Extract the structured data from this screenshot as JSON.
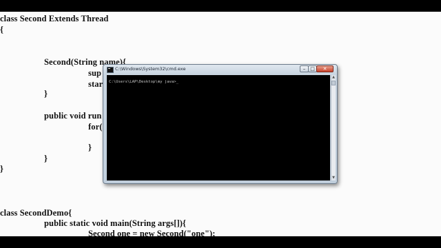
{
  "code_lines": [
    "class Second Extends Thread",
    "{",
    "Second(String name){",
    "sup",
    "star",
    "}",
    "public void run",
    "for(",
    "}",
    "}",
    "}",
    "class SecondDemo{",
    "public static void main(String args[]){",
    "Second one = new Second(\"one\");"
  ],
  "cmd": {
    "title": "C:\\Windows\\System32\\cmd.exe",
    "prompt_line": "C:\\Users\\LAP\\Desktop\\my java>_",
    "buttons": {
      "minimize": "–",
      "maximize": "□",
      "close": "✕"
    },
    "scroll_up": "▲",
    "scroll_down": "▼",
    "icon": "console-icon"
  }
}
